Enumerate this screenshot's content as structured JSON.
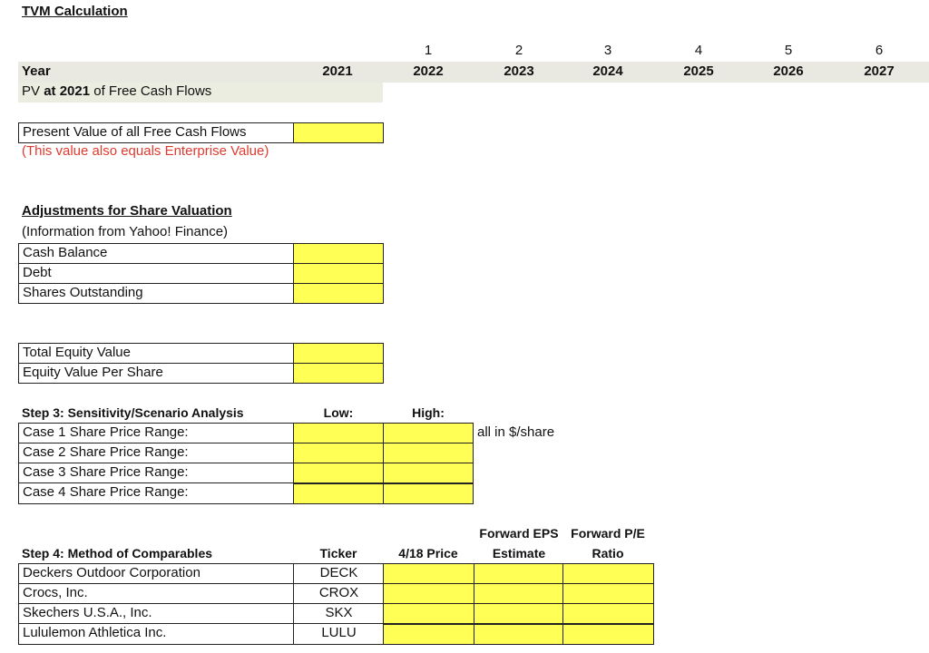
{
  "title": "TVM Calculation",
  "timeline": {
    "period_numbers": [
      "1",
      "2",
      "3",
      "4",
      "5",
      "6"
    ],
    "year_label": "Year",
    "years": [
      "2021",
      "2022",
      "2023",
      "2024",
      "2025",
      "2026",
      "2027"
    ],
    "pv_label_prefix": "PV ",
    "pv_label_bold": "at 2021",
    "pv_label_suffix": " of Free Cash Flows"
  },
  "pv_section": {
    "label": "Present Value of all Free Cash Flows",
    "value": "",
    "note": "(This value also equals Enterprise Value)"
  },
  "adjustments": {
    "heading": "Adjustments for Share Valuation",
    "source_note": "(Information from Yahoo! Finance)",
    "rows": [
      {
        "label": "Cash Balance",
        "value": ""
      },
      {
        "label": "Debt",
        "value": ""
      },
      {
        "label": "Shares Outstanding",
        "value": ""
      }
    ]
  },
  "equity": {
    "rows": [
      {
        "label": "Total Equity Value",
        "value": ""
      },
      {
        "label": "Equity Value Per Share",
        "value": ""
      }
    ]
  },
  "sensitivity": {
    "heading": "Step 3: Sensitivity/Scenario Analysis",
    "low_label": "Low:",
    "high_label": "High:",
    "unit_note": "all in $/share",
    "rows": [
      {
        "label": "Case 1 Share Price Range:",
        "low": "",
        "high": ""
      },
      {
        "label": "Case 2 Share Price Range:",
        "low": "",
        "high": ""
      },
      {
        "label": "Case 3 Share Price Range:",
        "low": "",
        "high": ""
      },
      {
        "label": "Case 4 Share Price Range:",
        "low": "",
        "high": ""
      }
    ]
  },
  "comparables": {
    "heading": "Step 4: Method of Comparables",
    "columns": {
      "ticker": "Ticker",
      "price": "4/18 Price",
      "eps_line1": "Forward EPS",
      "eps_line2": "Estimate",
      "pe_line1": "Forward P/E",
      "pe_line2": "Ratio"
    },
    "rows": [
      {
        "company": "Deckers Outdoor Corporation",
        "ticker": "DECK",
        "price": "",
        "eps": "",
        "pe": ""
      },
      {
        "company": "Crocs, Inc.",
        "ticker": "CROX",
        "price": "",
        "eps": "",
        "pe": ""
      },
      {
        "company": "Skechers U.S.A., Inc.",
        "ticker": "SKX",
        "price": "",
        "eps": "",
        "pe": ""
      },
      {
        "company": "Lululemon Athletica Inc.",
        "ticker": "LULU",
        "price": "",
        "eps": "",
        "pe": ""
      }
    ]
  },
  "colors": {
    "input_cell": "#ffff55",
    "header_band": "#e9e8e1",
    "note_red": "#e03a2f"
  }
}
